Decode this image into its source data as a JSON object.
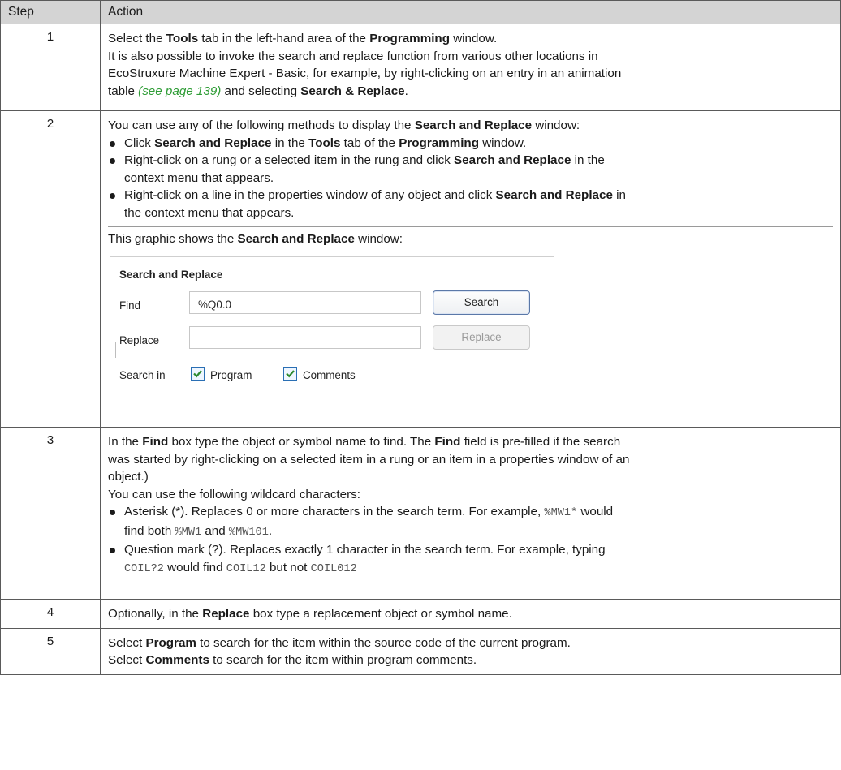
{
  "header": {
    "step": "Step",
    "action": "Action"
  },
  "rows": [
    {
      "step": "1",
      "l1a": "Select the ",
      "l1b": "Tools",
      "l1c": " tab in the left-hand area of the ",
      "l1d": "Programming",
      "l1e": " window.",
      "l2": "It is also possible to invoke the search and replace function from various other locations in",
      "l3": "EcoStruxure Machine Expert - Basic, for example, by right-clicking on an entry in an animation",
      "l4a": "table ",
      "l4ref": "(see page 139)",
      "l4b": " and selecting ",
      "l4c": "Search & Replace",
      "l4d": "."
    },
    {
      "step": "2",
      "intro_a": "You can use any of the following methods to display the ",
      "intro_b": "Search and Replace",
      "intro_c": " window:",
      "b1a": "Click ",
      "b1b": "Search and Replace",
      "b1c": " in the ",
      "b1d": "Tools",
      "b1e": " tab of the ",
      "b1f": "Programming",
      "b1g": " window.",
      "b2a": "Right-click on a rung or a selected item in the rung and click ",
      "b2b": "Search and Replace",
      "b2c": " in the",
      "b2d": "context menu that appears.",
      "b3a": "Right-click on a line in the properties window of any object and click ",
      "b3b": "Search and Replace",
      "b3c": " in",
      "b3d": "the context menu that appears.",
      "g_a": "This graphic shows the ",
      "g_b": "Search and Replace",
      "g_c": " window:",
      "dialog": {
        "title": "Search and Replace",
        "find_label": "Find",
        "find_value": "%Q0.0",
        "replace_label": "Replace",
        "replace_value": "",
        "search_button": "Search",
        "replace_button": "Replace",
        "search_in_label": "Search in",
        "program_label": "Program",
        "comments_label": "Comments",
        "program_checked": true,
        "comments_checked": true
      }
    },
    {
      "step": "3",
      "l1a": "In the ",
      "l1b": "Find",
      "l1c": " box type the object or symbol name to find. The ",
      "l1d": "Find",
      "l1e": " field is pre-filled if the search",
      "l2": "was started by right-clicking on a selected item in a rung or an item in a properties window of an",
      "l3": "object.)",
      "l4": "You can use the following wildcard characters:",
      "b1a": "Asterisk (*). Replaces 0 or more characters in the search term. For example, ",
      "b1code": "%MW1*",
      "b1b": " would",
      "b1c": "find both ",
      "b1code2": "%MW1",
      "b1d": " and ",
      "b1code3": "%MW101",
      "b1e": ".",
      "b2a": "Question mark (?). Replaces exactly 1 character in the search term. For example, typing",
      "b2code": "COIL?2",
      "b2b": " would find ",
      "b2code2": "COIL12",
      "b2c": " but not ",
      "b2code3": "COIL012"
    },
    {
      "step": "4",
      "a": "Optionally, in the ",
      "b": "Replace",
      "c": " box type a replacement object or symbol name."
    },
    {
      "step": "5",
      "l1a": "Select ",
      "l1b": "Program",
      "l1c": " to search for the item within the source code of the current program.",
      "l2a": "Select ",
      "l2b": "Comments",
      "l2c": " to search for the item within program comments."
    }
  ]
}
